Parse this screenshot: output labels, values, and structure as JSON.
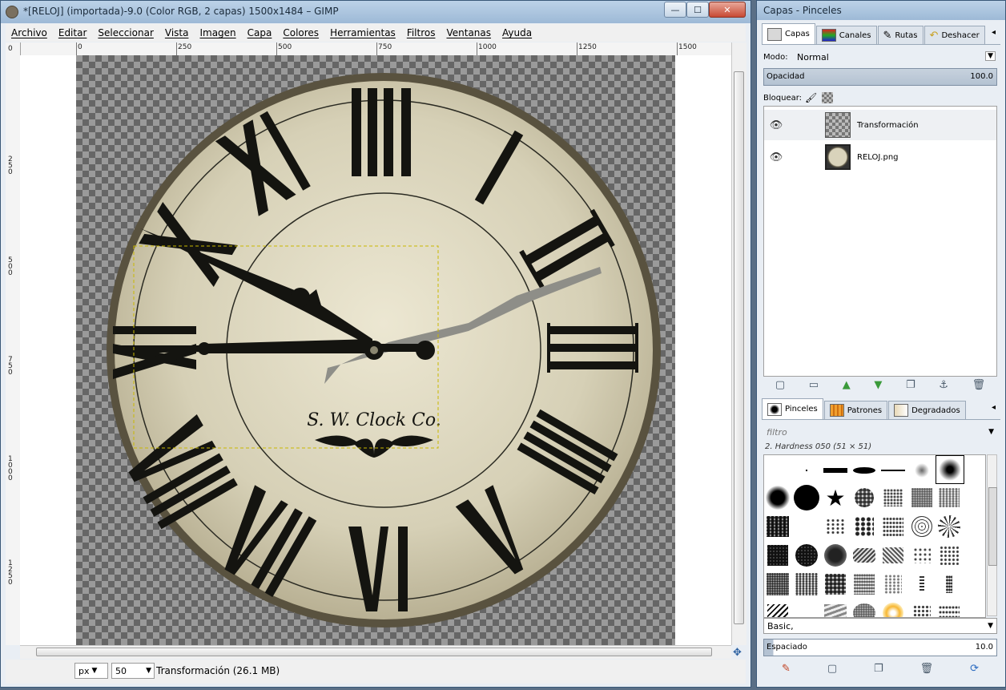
{
  "main_window": {
    "title": "*[RELOJ] (importada)-9.0 (Color RGB, 2 capas) 1500x1484 – GIMP",
    "controls": [
      "—",
      "☐",
      "✕"
    ],
    "menu": [
      "Archivo",
      "Editar",
      "Seleccionar",
      "Vista",
      "Imagen",
      "Capa",
      "Colores",
      "Herramientas",
      "Filtros",
      "Ventanas",
      "Ayuda"
    ],
    "ruler_h": [
      "0",
      "250",
      "500",
      "750",
      "1000",
      "1250",
      "1500"
    ],
    "ruler_v": [
      "0",
      "250",
      "500",
      "750",
      "1000",
      "1250"
    ],
    "status": {
      "unit": "px",
      "zoom": "50",
      "info": "Transformación (26.1 MB)"
    }
  },
  "clock": {
    "maker": "S. W. Clock Co."
  },
  "dock": {
    "title": "Capas - Pinceles",
    "tabs": [
      "Capas",
      "Canales",
      "Rutas",
      "Deshacer"
    ],
    "mode_label": "Modo:",
    "mode_value": "Normal",
    "opacity_label": "Opacidad",
    "opacity_value": "100.0",
    "lock_label": "Bloquear:",
    "layers": [
      {
        "name": "Transformación",
        "visible": true
      },
      {
        "name": "RELOJ.png",
        "visible": true
      }
    ],
    "brush_tabs": [
      "Pinceles",
      "Patrones",
      "Degradados"
    ],
    "filter_placeholder": "filtro",
    "brush_selected": "2. Hardness 050 (51 × 51)",
    "brush_tag": "Basic,",
    "spacing_label": "Espaciado",
    "spacing_value": "10.0"
  }
}
